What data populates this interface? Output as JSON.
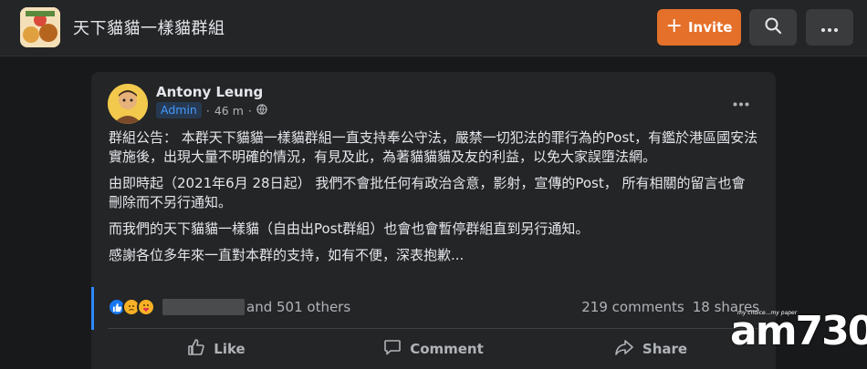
{
  "header": {
    "group_name": "天下貓貓一樣貓群組",
    "invite_label": "Invite"
  },
  "post": {
    "author": "Antony Leung",
    "badge": "Admin",
    "time": "46 m",
    "paragraphs": [
      "群組公告： 本群天下貓貓一樣貓群組一直支持奉公守法，嚴禁一切犯法的罪行為的Post，有鑑於港區國安法實施後，出現大量不明確的情況，有見及此，為著貓貓貓及友的利益，以免大家誤墮法網。",
      "由即時起（2021年6月 28日起） 我們不會批任何有政治含意，影射，宣傳的Post， 所有相關的留言也會刪除而不另行通知。",
      "而我們的天下貓貓一樣貓（自由出Post群組）也會也會暫停群組直到另行通知。",
      "感謝各位多年來一直對本群的支持，如有不便，深表抱歉..."
    ],
    "reactions_others": "and 501 others",
    "comments": "219 comments",
    "shares": "18 shares",
    "actions": {
      "like": "Like",
      "comment": "Comment",
      "share": "Share"
    }
  },
  "watermark": {
    "text": "am730",
    "tagline": "my choice...my paper"
  },
  "colors": {
    "invite_bg": "#e4702a",
    "admin_badge_text": "#4599ff",
    "accent_bar": "#2d88ff"
  },
  "icons": {
    "search": "search-icon",
    "more": "more-horizontal-icon",
    "globe": "globe-icon",
    "like": "thumbs-up-icon",
    "comment": "comment-bubble-icon",
    "share": "share-arrow-icon"
  }
}
